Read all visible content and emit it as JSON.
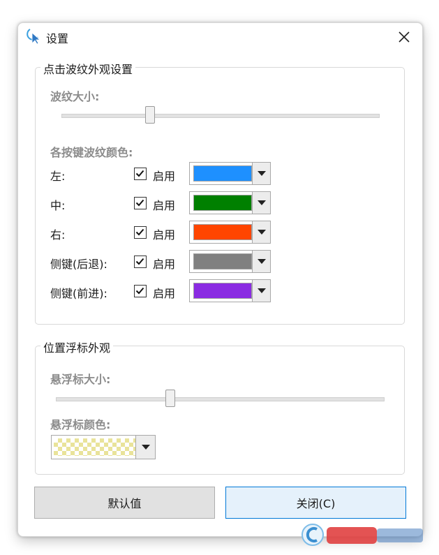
{
  "window": {
    "title": "设置",
    "close_icon": "×"
  },
  "ripple_group": {
    "legend": "点击波纹外观设置",
    "size_label": "波纹大小:",
    "size_value": 0.28,
    "color_label": "各按键波纹颜色:",
    "rows": [
      {
        "label": "左:",
        "enabled_label": "启用",
        "checked": true,
        "color": "#1e90ff"
      },
      {
        "label": "中:",
        "enabled_label": "启用",
        "checked": true,
        "color": "#008000"
      },
      {
        "label": "右:",
        "enabled_label": "启用",
        "checked": true,
        "color": "#ff4500"
      },
      {
        "label": "侧键(后退):",
        "enabled_label": "启用",
        "checked": true,
        "color": "#808080"
      },
      {
        "label": "侧键(前进):",
        "enabled_label": "启用",
        "checked": true,
        "color": "#8a2be2"
      }
    ]
  },
  "hover_group": {
    "legend": "位置浮标外观",
    "size_label": "悬浮标大小:",
    "size_value": 0.35,
    "color_label": "悬浮标颜色:",
    "color": "#f5f0a0"
  },
  "buttons": {
    "default_label": "默认值",
    "close_label": "关闭(C)"
  },
  "colors": {
    "accent": "#0078d7"
  }
}
